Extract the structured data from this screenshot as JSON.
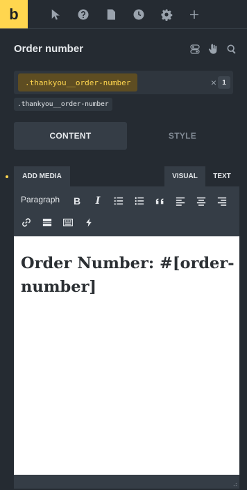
{
  "toolbar": {
    "logo": "b",
    "icons": [
      "pointer-icon",
      "help-icon",
      "pages-icon",
      "history-icon",
      "settings-icon",
      "add-icon"
    ]
  },
  "panel": {
    "title": "Order number",
    "header_icons": [
      "toggle-icon",
      "hand-icon",
      "search-icon"
    ]
  },
  "selector": {
    "active_class": ".thankyou__order-number",
    "clear_symbol": "×",
    "count": "1",
    "class_tag": ".thankyou__order-number"
  },
  "tabs": {
    "content": "CONTENT",
    "style": "STYLE",
    "active": "CONTENT"
  },
  "editor": {
    "add_media": "ADD MEDIA",
    "visual_tab": "VISUAL",
    "text_tab": "TEXT",
    "format_select": "Paragraph",
    "tools": [
      "bold-icon",
      "italic-icon",
      "bullet-list-icon",
      "numbered-list-icon",
      "blockquote-icon",
      "align-left-icon",
      "align-center-icon",
      "align-right-icon",
      "link-icon",
      "read-more-icon",
      "toolbar-toggle-icon",
      "dynamic-data-icon"
    ],
    "content": "Order Number: #[order-number]"
  },
  "colors": {
    "accent": "#ffd64f",
    "panel_bg": "#252b32",
    "control_bg": "#353d46",
    "chip_bg": "#5e4d22"
  }
}
